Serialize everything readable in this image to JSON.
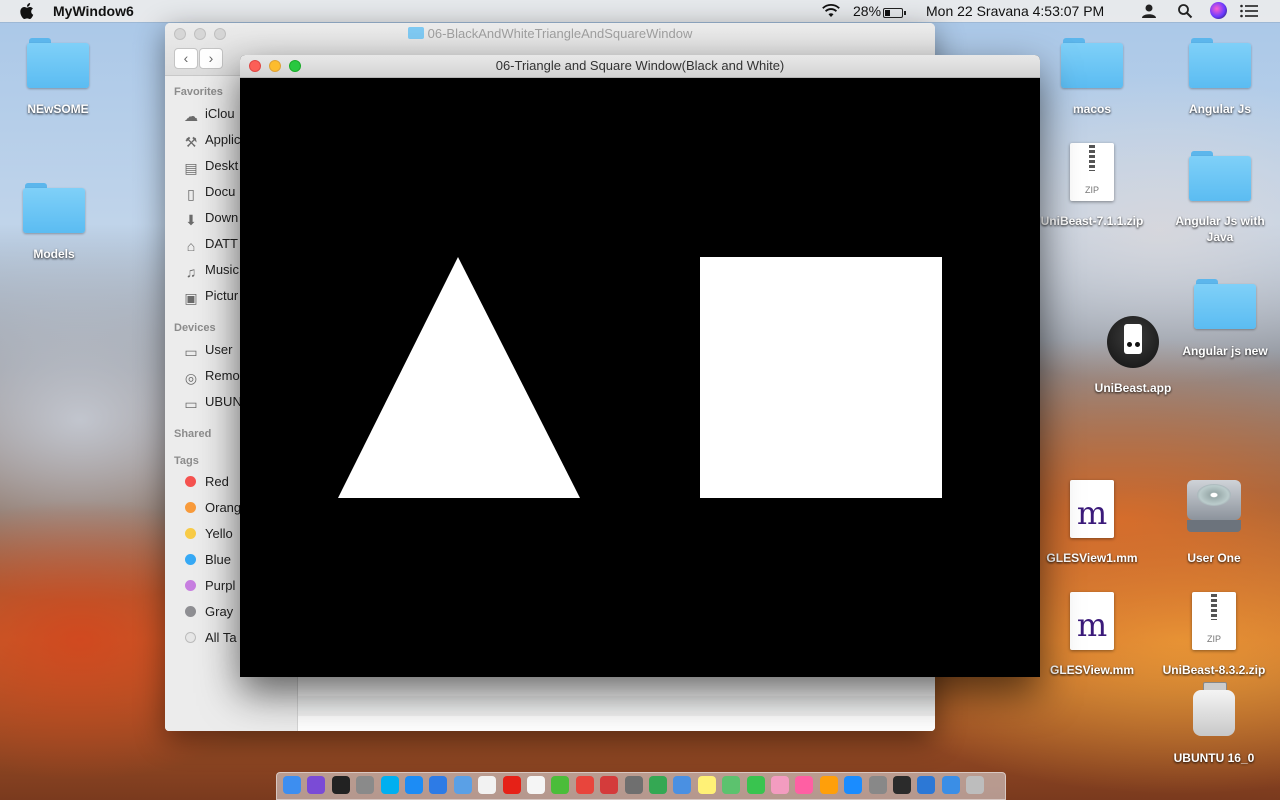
{
  "menubar": {
    "app_name": "MyWindow6",
    "battery": "28%",
    "clock": "Mon 22 Sravana  4:53:07 PM",
    "icons": [
      "apple-icon",
      "wifi-icon",
      "battery-icon",
      "user-icon",
      "spotlight-icon",
      "siri-icon",
      "notification-center-icon"
    ]
  },
  "desktop": {
    "left_icons": [
      {
        "label": "NEwSOME",
        "icon": "folder-icon"
      },
      {
        "label": "Models",
        "icon": "folder-icon"
      }
    ],
    "right_icons": [
      {
        "label": "macos",
        "icon": "folder-icon"
      },
      {
        "label": "Angular Js",
        "icon": "folder-icon"
      },
      {
        "label": "UniBeast-7.1.1.zip",
        "icon": "zip-file-icon"
      },
      {
        "label": "Angular Js with Java",
        "icon": "folder-icon"
      },
      {
        "label": "UniBeast.app",
        "icon": "app-icon"
      },
      {
        "label": "Angular js new",
        "icon": "folder-icon"
      },
      {
        "label": "GLESView1.mm",
        "icon": "mm-file-icon"
      },
      {
        "label": "User One",
        "icon": "hard-drive-icon"
      },
      {
        "label": "GLESView.mm",
        "icon": "mm-file-icon"
      },
      {
        "label": "UniBeast-8.3.2.zip",
        "icon": "zip-file-icon"
      },
      {
        "label": "UBUNTU 16_0",
        "icon": "external-drive-icon"
      }
    ]
  },
  "finder": {
    "title": "06-BlackAndWhiteTriangleAndSquareWindow",
    "sidebar": {
      "favorites_header": "Favorites",
      "favorites": [
        {
          "label": "iClou",
          "icon": "cloud-icon"
        },
        {
          "label": "Applic",
          "icon": "applications-icon"
        },
        {
          "label": "Deskt",
          "icon": "desktop-icon"
        },
        {
          "label": "Docu",
          "icon": "documents-icon"
        },
        {
          "label": "Down",
          "icon": "downloads-icon"
        },
        {
          "label": "DATT",
          "icon": "home-icon"
        },
        {
          "label": "Music",
          "icon": "music-icon"
        },
        {
          "label": "Pictur",
          "icon": "pictures-icon"
        }
      ],
      "devices_header": "Devices",
      "devices": [
        {
          "label": "User",
          "icon": "disk-icon"
        },
        {
          "label": "Remo",
          "icon": "remote-disc-icon"
        },
        {
          "label": "UBUN",
          "icon": "disk-icon"
        }
      ],
      "shared_header": "Shared",
      "tags_header": "Tags",
      "tags": [
        {
          "label": "Red",
          "color": "#f5524f"
        },
        {
          "label": "Orang",
          "color": "#f89a3a"
        },
        {
          "label": "Yello",
          "color": "#f8cb46"
        },
        {
          "label": "Blue",
          "color": "#36a9f5"
        },
        {
          "label": "Purpl",
          "color": "#c77ee0"
        },
        {
          "label": "Gray",
          "color": "#8e8e92"
        },
        {
          "label": "All Ta",
          "color": "#e6e6e6"
        }
      ]
    }
  },
  "gl_window": {
    "title": "06-Triangle and Square Window(Black and White)",
    "background": "#000000",
    "shape_color": "#ffffff",
    "shapes": [
      "triangle",
      "square"
    ]
  },
  "dock": {
    "apps": [
      "finder-icon",
      "siri-icon",
      "terminal-icon",
      "launchpad-icon",
      "skype-icon",
      "safari-icon",
      "appstore-icon",
      "preview-icon",
      "textedit-icon",
      "youtube-icon",
      "calendar-icon",
      "utorrent-icon",
      "chrome-icon",
      "photo-booth-icon",
      "calculator-icon",
      "chrome-icon",
      "app-icon",
      "notes-icon",
      "maps-icon",
      "messages-icon",
      "photos-icon",
      "itunes-icon",
      "books-icon",
      "app-store-icon",
      "system-preferences-icon",
      "dvd-icon",
      "xcode-icon",
      "downloads-icon",
      "trash-icon"
    ]
  }
}
